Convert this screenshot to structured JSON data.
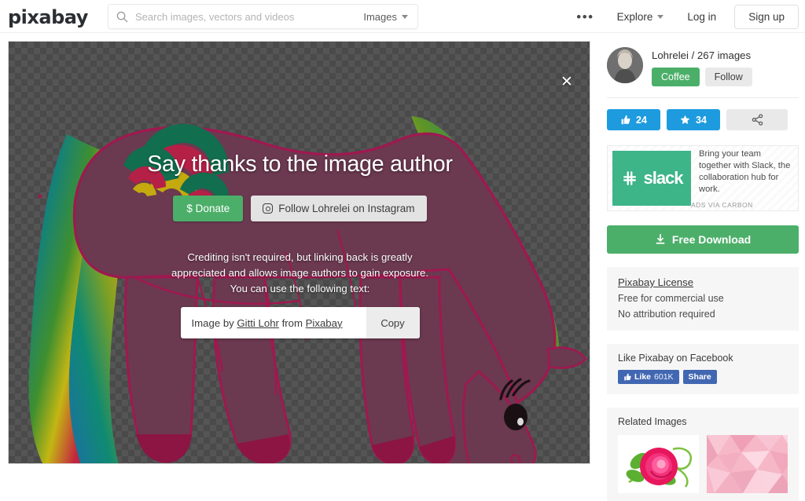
{
  "header": {
    "logo_text": "pixabay",
    "search": {
      "placeholder": "Search images, vectors and videos",
      "value": "",
      "type_label": "Images",
      "icon": "search-icon"
    },
    "more_dots": "•••",
    "explore_label": "Explore",
    "login_label": "Log in",
    "signup_label": "Sign up"
  },
  "image_panel": {
    "close_label": "✕",
    "transparency_checker": true,
    "subject": "grazing unicorn horse with rainbow mane and tail"
  },
  "modal": {
    "title": "Say thanks to the image author",
    "donate_label": "$ Donate",
    "instagram_label": "Follow Lohrelei on Instagram",
    "instagram_icon": "instagram-icon",
    "note_line1": "Crediting isn't required, but linking back is greatly",
    "note_line2": "appreciated and allows image authors to gain exposure.",
    "note_line3": "You can use the following text:",
    "credit_prefix": "Image by ",
    "credit_author": "Gitti Lohr",
    "credit_middle": " from ",
    "credit_site": "Pixabay",
    "copy_label": "Copy"
  },
  "sidebar": {
    "author": {
      "name_line": "Lohrelei / 267 images",
      "coffee_label": "Coffee",
      "follow_label": "Follow"
    },
    "stats": {
      "like_icon": "thumbs-up-icon",
      "like_count": "24",
      "star_icon": "star-icon",
      "star_count": "34",
      "share_icon": "share-icon"
    },
    "ad": {
      "brand": "slack",
      "brand_icon": "slack-hash-icon",
      "text": "Bring your team together with Slack, the collaboration hub for work.",
      "via": "ADS VIA CARBON"
    },
    "download": {
      "icon": "download-icon",
      "label": "Free Download"
    },
    "license": {
      "title": "Pixabay License",
      "line1": "Free for commercial use",
      "line2": "No attribution required"
    },
    "facebook": {
      "title": "Like Pixabay on Facebook",
      "like_icon": "facebook-thumb-icon",
      "like_label": "Like",
      "like_count": "601K",
      "share_label": "Share"
    },
    "related": {
      "title": "Related Images",
      "items": [
        {
          "name": "pink-rose-with-swirls"
        },
        {
          "name": "pink-low-poly-background"
        }
      ]
    }
  },
  "colors": {
    "green": "#4caf69",
    "blue": "#1e9bdf",
    "facebook_blue": "#4267b2",
    "slack_green": "#3eb489",
    "horse_body": "#6b3950",
    "horse_outline": "#a01850"
  }
}
